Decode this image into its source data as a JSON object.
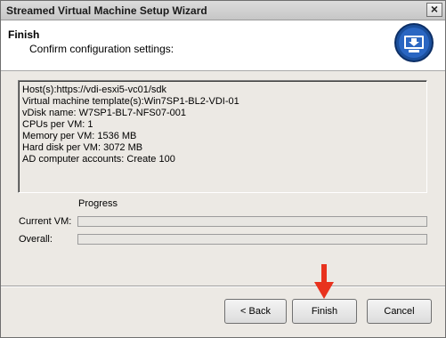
{
  "window": {
    "title": "Streamed Virtual Machine Setup Wizard",
    "close_symbol": "×"
  },
  "header": {
    "title": "Finish",
    "subtitle": "Confirm configuration settings:",
    "icon": "download-to-monitor-icon"
  },
  "summary": {
    "lines": [
      "Host(s):https://vdi-esxi5-vc01/sdk",
      "Virtual machine template(s):Win7SP1-BL2-VDI-01",
      "vDisk name: W7SP1-BL7-NFS07-001",
      "CPUs per VM: 1",
      "Memory per VM: 1536 MB",
      "Hard disk per VM: 3072 MB",
      "AD computer accounts: Create 100"
    ]
  },
  "progress": {
    "heading": "Progress",
    "current_label": "Current VM:",
    "current_value": 0,
    "overall_label": "Overall:",
    "overall_value": 0
  },
  "buttons": {
    "back": "< Back",
    "finish": "Finish",
    "cancel": "Cancel"
  },
  "colors": {
    "accent_icon": "#1b4f9c",
    "annotation_arrow": "#e8321e"
  }
}
